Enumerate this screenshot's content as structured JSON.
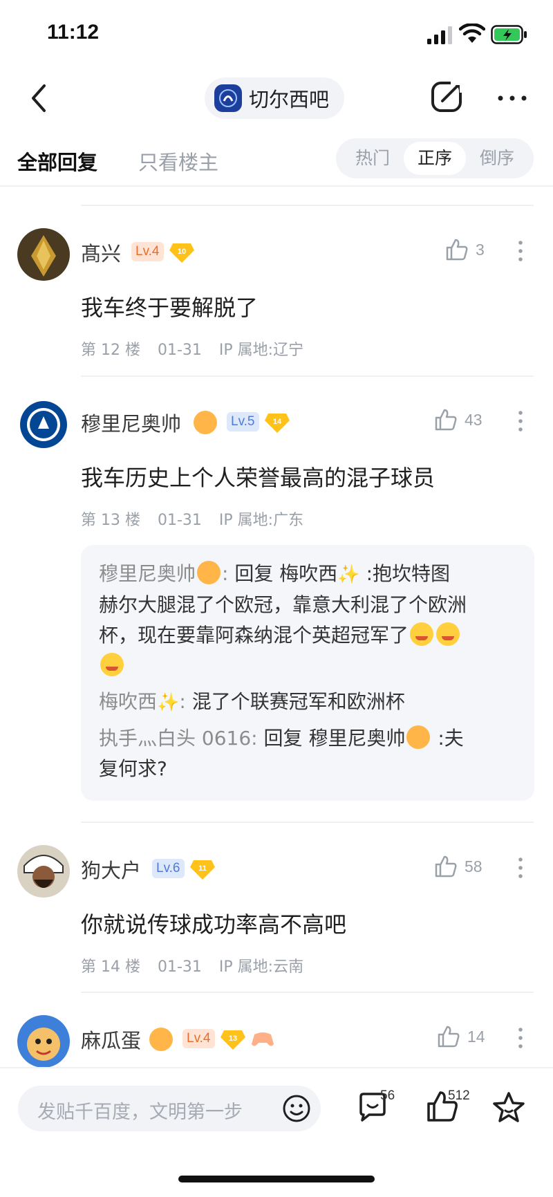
{
  "status_bar": {
    "time": "11:12"
  },
  "nav": {
    "forum_name": "切尔西吧"
  },
  "tabs": {
    "all_replies": "全部回复",
    "op_only": "只看楼主",
    "sort": [
      "热门",
      "正序",
      "倒序"
    ],
    "active_sort": "正序"
  },
  "posts": [
    {
      "username": "髙兴",
      "level": "Lv.4",
      "gem_level": "10",
      "likes": "3",
      "content": "我车终于要解脱了",
      "floor": "第 12 楼",
      "date": "01-31",
      "ip": "IP 属地:辽宁"
    },
    {
      "username": "穆里尼奥帅",
      "level": "Lv.5",
      "gem_level": "14",
      "likes": "43",
      "content": "我车历史上个人荣誉最高的混子球员",
      "floor": "第 13 楼",
      "date": "01-31",
      "ip": "IP 属地:广东",
      "replies": [
        {
          "name": "穆里尼奥帅",
          "prefix": "回复",
          "target": "梅吹西",
          "text_line1": ":抱坎特图",
          "text_line2": "赫尔大腿混了个欧冠，靠意大利混了个欧洲",
          "text_line3": "杯，现在要靠阿森纳混个英超冠军了"
        },
        {
          "name": "梅吹西",
          "text": "混了个联赛冠军和欧洲杯"
        },
        {
          "name": "执手灬白头 0616",
          "prefix": "回复",
          "target": "穆里尼奥帅",
          "text_line1": ":夫",
          "text_line2": "复何求?"
        }
      ]
    },
    {
      "username": "狗大户",
      "level": "Lv.6",
      "gem_level": "11",
      "likes": "58",
      "content": "你就说传球成功率高不高吧",
      "floor": "第 14 楼",
      "date": "01-31",
      "ip": "IP 属地:云南"
    },
    {
      "username": "麻瓜蛋",
      "level": "Lv.4",
      "gem_level": "13",
      "likes": "14"
    }
  ],
  "bottom_bar": {
    "compose_placeholder": "发贴千百度，文明第一步",
    "comment_count": "56",
    "like_count": "512"
  }
}
